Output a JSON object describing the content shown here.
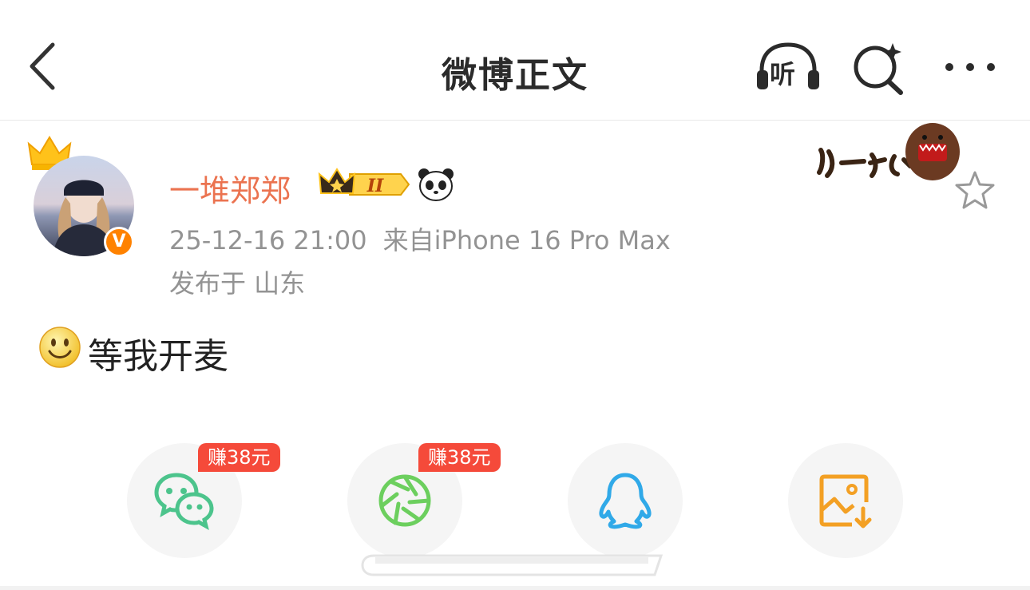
{
  "header": {
    "title": "微博正文",
    "listen_label": "听",
    "back_icon": "back-arrow-icon",
    "search_icon": "ai-search-icon",
    "more_icon": "more-dots-icon"
  },
  "post": {
    "username": "一堆郑郑",
    "username_color": "#eb7350",
    "verified_badge": "V",
    "timestamp": "25-12-16 21:00",
    "source": "来自iPhone 16 Pro Max",
    "location": "发布于 山东",
    "vip_level": "II",
    "content": "等我开麦",
    "content_emoji": "smile-emoji-icon",
    "favorite_icon": "star-outline-icon"
  },
  "share": {
    "items": [
      {
        "name": "wechat",
        "reward": "赚38元",
        "color": "#4cc48c"
      },
      {
        "name": "moments",
        "reward": "赚38元",
        "color": "#6ccf5e"
      },
      {
        "name": "qq",
        "reward": "",
        "color": "#30a9e8"
      },
      {
        "name": "save-image",
        "reward": "",
        "color": "#f3a024"
      }
    ]
  },
  "colors": {
    "accent": "#ff8200",
    "reward_bg": "#f54a3a"
  }
}
